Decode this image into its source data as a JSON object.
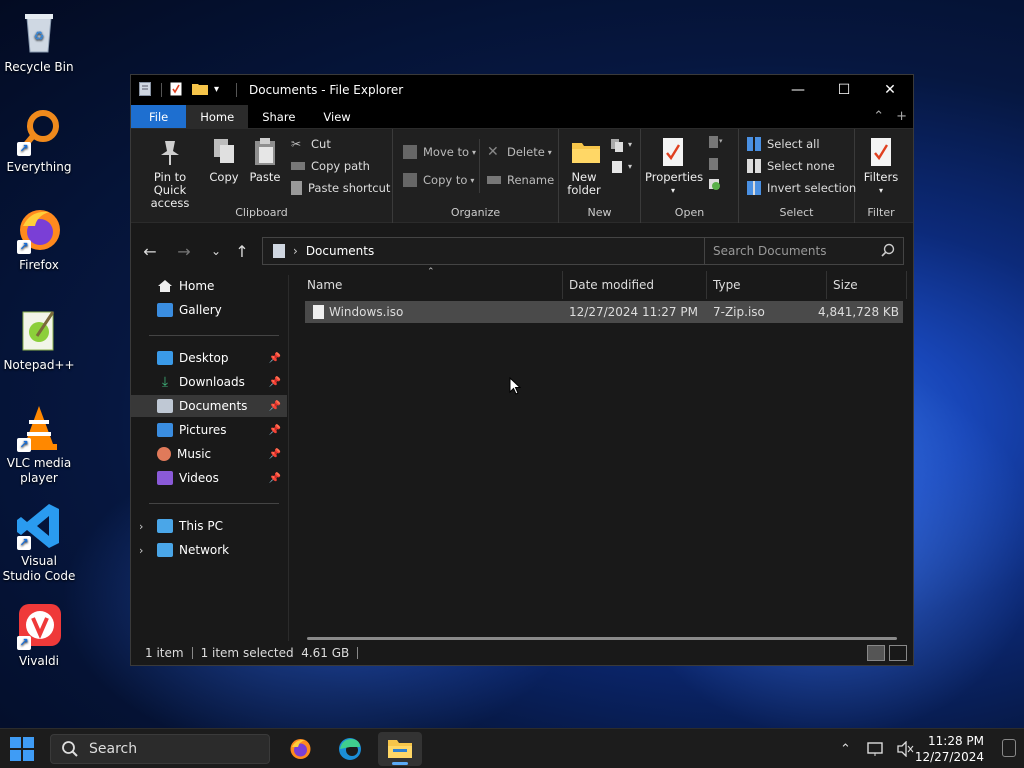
{
  "desktop": {
    "icons": [
      {
        "label": "Recycle Bin"
      },
      {
        "label": "Everything"
      },
      {
        "label": "Firefox"
      },
      {
        "label": "Notepad++"
      },
      {
        "label": "VLC media player"
      },
      {
        "label": "Visual Studio Code"
      },
      {
        "label": "Vivaldi"
      }
    ]
  },
  "window": {
    "title": "Documents - File Explorer",
    "controls": {
      "minimize": "—",
      "maximize": "☐",
      "close": "✕"
    }
  },
  "tabs": {
    "file": "File",
    "home": "Home",
    "share": "Share",
    "view": "View"
  },
  "ribbon": {
    "clipboard": {
      "label": "Clipboard",
      "pin": "Pin to Quick access",
      "copy": "Copy",
      "paste": "Paste",
      "cut": "Cut",
      "copy_path": "Copy path",
      "paste_shortcut": "Paste shortcut"
    },
    "organize": {
      "label": "Organize",
      "move_to": "Move to",
      "copy_to": "Copy to",
      "delete": "Delete",
      "rename": "Rename"
    },
    "new": {
      "label": "New",
      "new_folder": "New folder"
    },
    "open": {
      "label": "Open",
      "properties": "Properties"
    },
    "select": {
      "label": "Select",
      "select_all": "Select all",
      "select_none": "Select none",
      "invert": "Invert selection"
    },
    "filter": {
      "label": "Filter",
      "filters": "Filters"
    }
  },
  "address": {
    "path": "Documents",
    "search_placeholder": "Search Documents"
  },
  "nav": {
    "home": "Home",
    "gallery": "Gallery",
    "desktop": "Desktop",
    "downloads": "Downloads",
    "documents": "Documents",
    "pictures": "Pictures",
    "music": "Music",
    "videos": "Videos",
    "this_pc": "This PC",
    "network": "Network"
  },
  "columns": {
    "name": "Name",
    "date": "Date modified",
    "type": "Type",
    "size": "Size"
  },
  "files": [
    {
      "name": "Windows.iso",
      "date": "12/27/2024 11:27 PM",
      "type": "7-Zip.iso",
      "size": "4,841,728 KB"
    }
  ],
  "status": {
    "count": "1 item",
    "selected": "1 item selected  4.61 GB"
  },
  "taskbar": {
    "search": "Search",
    "time": "11:28 PM",
    "date": "12/27/2024"
  },
  "colors": {
    "accent": "#1e6fd0",
    "selection": "#4a4a4a"
  }
}
